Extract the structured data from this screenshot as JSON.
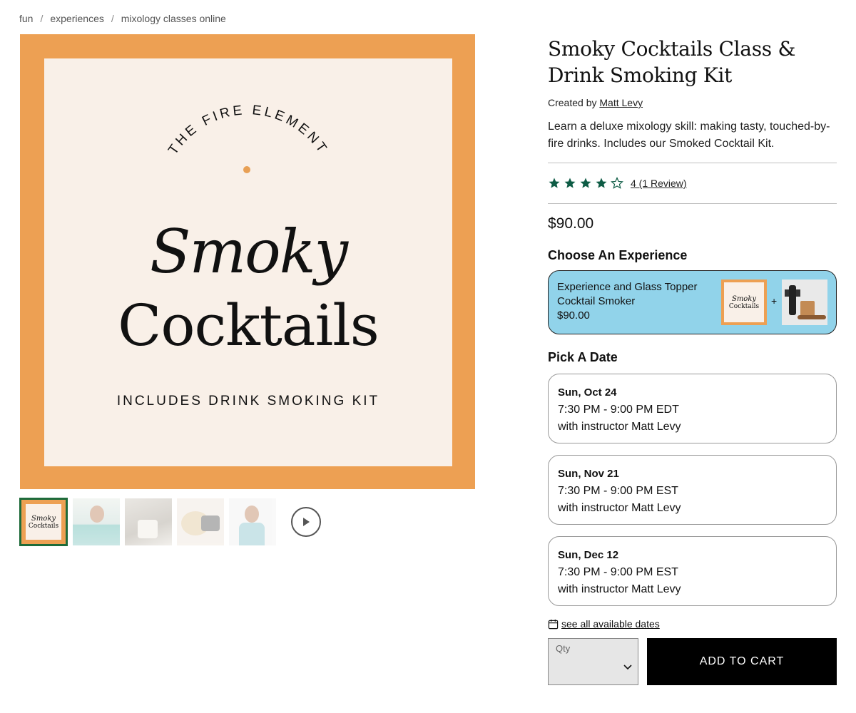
{
  "breadcrumb": {
    "items": [
      "fun",
      "experiences",
      "mixology classes online"
    ],
    "separator": "/"
  },
  "hero": {
    "arc_text": "THE FIRE ELEMENT",
    "word1": "Smoky",
    "word2": "Cocktails",
    "tagline": "INCLUDES DRINK SMOKING KIT",
    "colors": {
      "frame": "#eda053",
      "panel": "#f9f0e8"
    }
  },
  "thumbnails": {
    "count": 5,
    "active_index": 0,
    "thumb1": {
      "word1": "Smoky",
      "word2": "Cocktails"
    },
    "play_icon": "play-icon"
  },
  "product": {
    "title": "Smoky Cocktails Class & Drink Smoking Kit",
    "created_by_prefix": "Created by",
    "creator": "Matt Levy",
    "description": "Learn a deluxe mixology skill: making tasty, touched-by-fire drinks. Includes our Smoked Cocktail Kit.",
    "rating": {
      "value": 4,
      "max": 5,
      "link_text": "4 (1 Review)",
      "color": "#0e5c45"
    },
    "price": "$90.00"
  },
  "experience": {
    "heading": "Choose An Experience",
    "option": {
      "label": "Experience and Glass Topper Cocktail Smoker",
      "price": "$90.00",
      "plus": "+",
      "thumb_word1": "Smoky",
      "thumb_word2": "Cocktails",
      "background": "#91d3ea"
    }
  },
  "dates": {
    "heading": "Pick A Date",
    "items": [
      {
        "day": "Sun, Oct 24",
        "time": "7:30 PM - 9:00 PM EDT",
        "instructor": "with instructor Matt Levy"
      },
      {
        "day": "Sun, Nov 21",
        "time": "7:30 PM - 9:00 PM EST",
        "instructor": "with instructor Matt Levy"
      },
      {
        "day": "Sun, Dec 12",
        "time": "7:30 PM - 9:00 PM EST",
        "instructor": "with instructor Matt Levy"
      }
    ],
    "see_all": "see all available dates"
  },
  "purchase": {
    "qty_label": "Qty",
    "add_to_cart": "ADD TO CART"
  }
}
